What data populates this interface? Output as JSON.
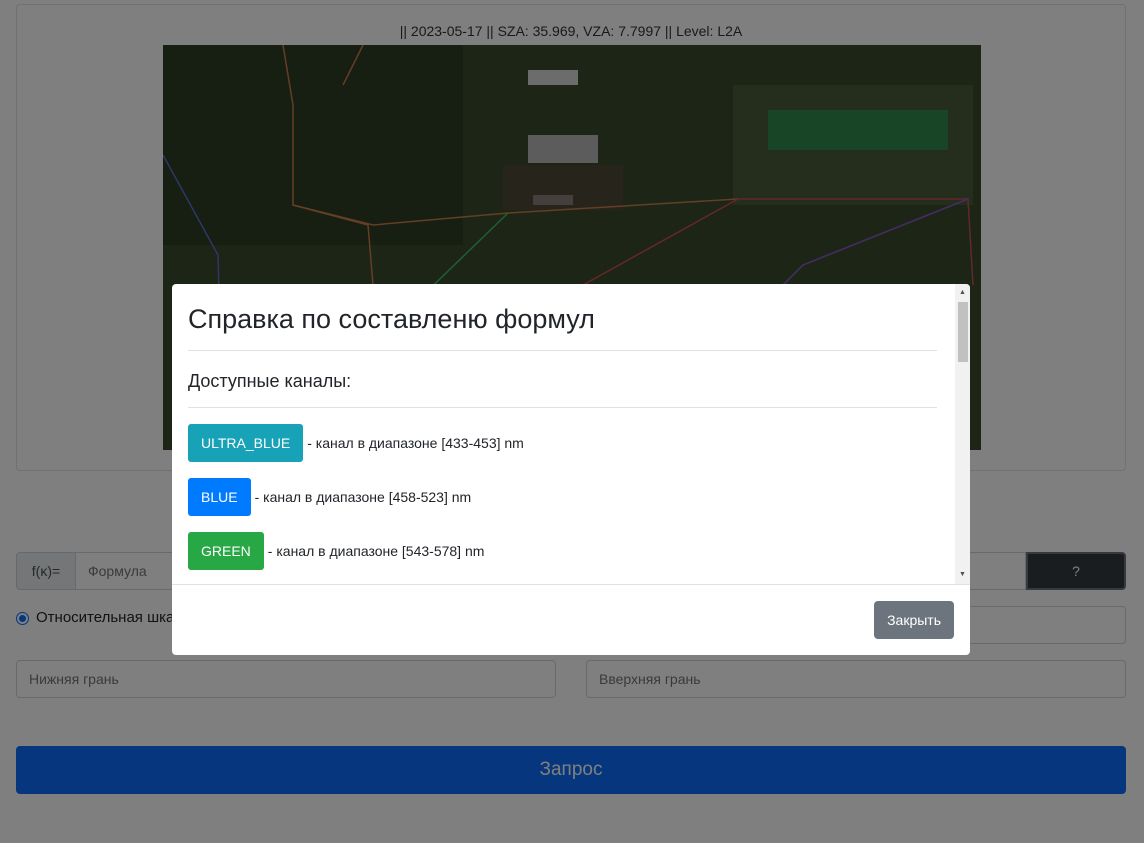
{
  "image": {
    "caption": "|| 2023-05-17 || SZA: 35.969, VZA: 7.7997 || Level: L2A"
  },
  "form": {
    "fx_label": "f(κ)=",
    "formula_placeholder": "Формула",
    "help_label": "?",
    "relative_scale_label": "Относительная шка",
    "lower_placeholder": "Нижняя грань",
    "upper_placeholder": "Вверхняя грань",
    "request_label": "Запрос"
  },
  "modal": {
    "title": "Справка по составленю формул",
    "section_heading": "Доступные каналы:",
    "channels": [
      {
        "name": "ULTRA_BLUE",
        "description": "- канал в диапазоне [433-453] nm",
        "color": "#17a2b8"
      },
      {
        "name": "BLUE",
        "description": "- канал в диапазоне [458-523] nm",
        "color": "#007bff"
      },
      {
        "name": "GREEN",
        "description": "- канал в диапазоне [543-578] nm",
        "color": "#28a745"
      }
    ],
    "close_label": "Закрыть"
  },
  "colors": {
    "primary": "#0d6efd",
    "secondary": "#6c757d",
    "dark": "#343a40"
  }
}
